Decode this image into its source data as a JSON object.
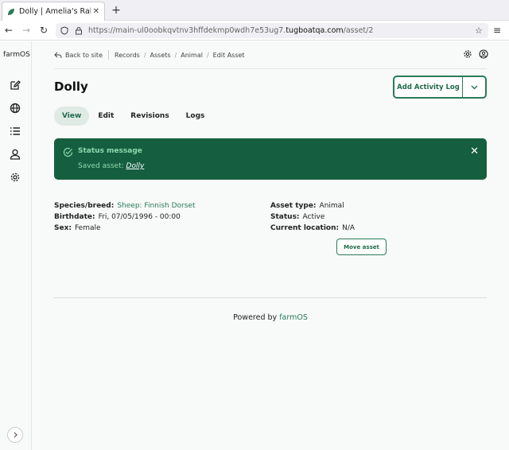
{
  "browser": {
    "tab_title": "Dolly | Amelia's Rabbit Fa",
    "url_prefix": "https://main-ul0oobkqvtnv3hffdekmp0wdh7e53ug7.",
    "url_domain": "tugboatqa.com",
    "url_path": "/asset/2"
  },
  "sidebar": {
    "brand": "farmOS",
    "icons": [
      "edit-icon",
      "globe-icon",
      "list-icon",
      "user-icon",
      "gear-icon"
    ]
  },
  "breadcrumb": {
    "back": "Back to site",
    "items": [
      "Records",
      "Assets",
      "Animal",
      "Edit Asset"
    ]
  },
  "page": {
    "title": "Dolly",
    "action_label": "Add Activity Log"
  },
  "tabs": [
    "View",
    "Edit",
    "Revisions",
    "Logs"
  ],
  "message": {
    "title": "Status message",
    "body_prefix": "Saved asset: ",
    "body_link": "Dolly"
  },
  "details": {
    "left": [
      {
        "key": "Species/breed:",
        "value": "Sheep: Finnish Dorset",
        "link": true
      },
      {
        "key": "Birthdate:",
        "value": "Fri, 07/05/1996 - 00:00",
        "link": false
      },
      {
        "key": "Sex:",
        "value": "Female",
        "link": false
      }
    ],
    "right": [
      {
        "key": "Asset type:",
        "value": "Animal"
      },
      {
        "key": "Status:",
        "value": "Active"
      },
      {
        "key": "Current location:",
        "value": "N/A"
      }
    ],
    "move_label": "Move asset"
  },
  "footer": {
    "prefix": "Powered by ",
    "link": "farmOS"
  },
  "colors": {
    "accent": "#2a7a59",
    "message_bg": "#155e40"
  }
}
